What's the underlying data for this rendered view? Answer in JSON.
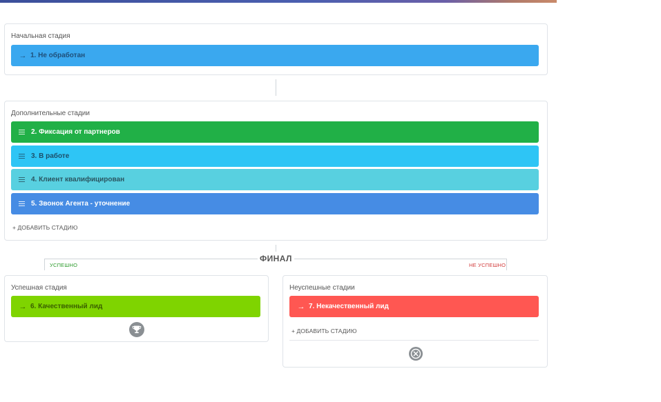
{
  "initial": {
    "title": "Начальная стадия",
    "stage": {
      "label": "1. Не обработан",
      "icon": "arrow-right-icon",
      "color": "#3aa8ef",
      "text_color": "#1f4f7a"
    }
  },
  "additional": {
    "title": "Дополнительные стадии",
    "stages": [
      {
        "label": "2. Фиксация от партнеров",
        "icon": "drag-handle-icon",
        "color": "#21b047",
        "text_color": "#ffffff"
      },
      {
        "label": "3. В работе",
        "icon": "drag-handle-icon",
        "color": "#2ec5f5",
        "text_color": "#1d4f6a"
      },
      {
        "label": "4. Клиент квалифицирован",
        "icon": "drag-handle-icon",
        "color": "#58d0e0",
        "text_color": "#2a5560"
      },
      {
        "label": "5. Звонок Агента - уточнение",
        "icon": "drag-handle-icon",
        "color": "#468ce4",
        "text_color": "#ffffff"
      }
    ],
    "add_label": "+ ДОБАВИТЬ СТАДИЮ"
  },
  "final": {
    "title": "ФИНАЛ",
    "success_tag": "УСПЕШНО",
    "fail_tag": "НЕ УСПЕШНО",
    "success_color": "#2c9b2c",
    "fail_color": "#d23c3c"
  },
  "success": {
    "title": "Успешная стадия",
    "stage": {
      "label": "6. Качественный лид",
      "icon": "arrow-right-icon",
      "color": "#7fd400",
      "text_color": "#3a5f00"
    },
    "footer_icon": "trophy-icon"
  },
  "fail": {
    "title": "Неуспешные стадии",
    "stage": {
      "label": "7. Некачественный лид",
      "icon": "arrow-right-icon",
      "color": "#ff5752",
      "text_color": "#ffffff"
    },
    "add_label": "+ ДОБАВИТЬ СТАДИЮ",
    "footer_icon": "close-circle-icon"
  }
}
